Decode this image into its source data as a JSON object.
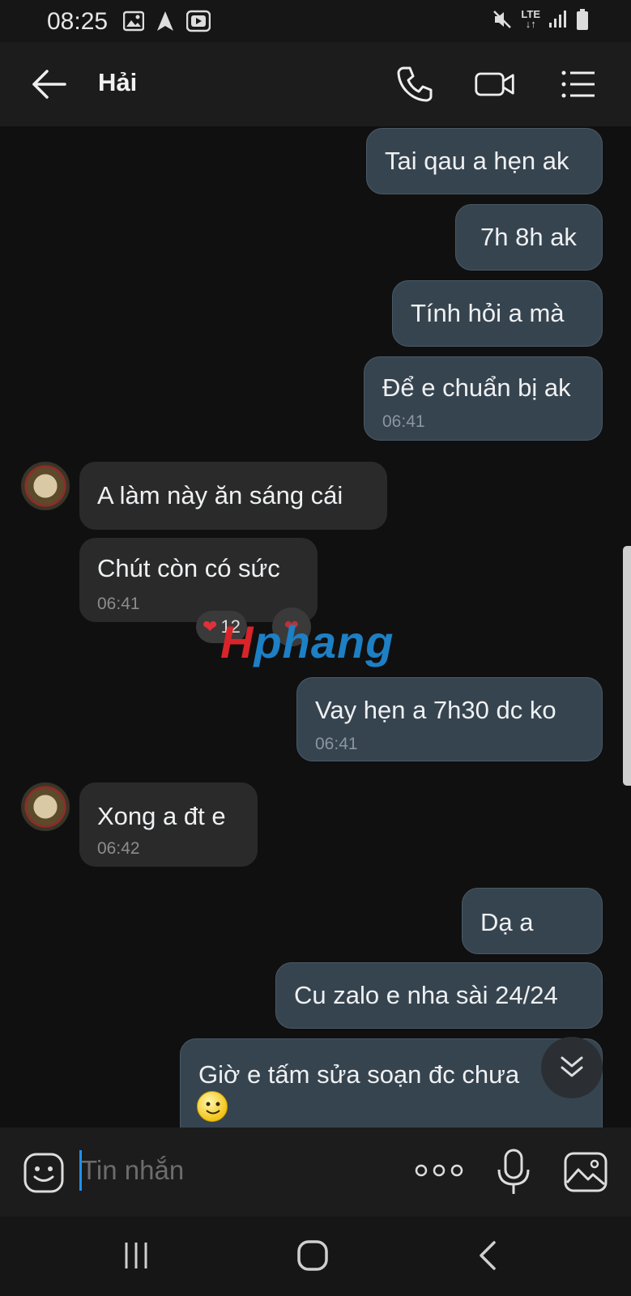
{
  "status_bar": {
    "time": "08:25",
    "network": "LTE"
  },
  "header": {
    "contact_name": "Hải"
  },
  "messages": [
    {
      "dir": "out",
      "text": "Tai qau a hẹn ak",
      "time": ""
    },
    {
      "dir": "out",
      "text": "7h 8h ak",
      "time": ""
    },
    {
      "dir": "out",
      "text": "Tính hỏi a mà",
      "time": ""
    },
    {
      "dir": "out",
      "text": "Để e chuẩn bị ak",
      "time": "06:41"
    },
    {
      "dir": "in",
      "text": "A làm này ăn sáng cái",
      "time": ""
    },
    {
      "dir": "in",
      "text": "Chút còn có sức",
      "time": "06:41"
    },
    {
      "dir": "out",
      "text": "Vay hẹn a 7h30 dc ko",
      "time": "06:41"
    },
    {
      "dir": "in",
      "text": "Xong a đt e",
      "time": "06:42"
    },
    {
      "dir": "out",
      "text": "Dạ a",
      "time": ""
    },
    {
      "dir": "out",
      "text": "Cu zalo e nha sài 24/24",
      "time": ""
    },
    {
      "dir": "out",
      "text": "Giờ e tấm sửa soạn đc chưa",
      "time": ""
    }
  ],
  "reaction": {
    "count": "12"
  },
  "watermark": {
    "part1": "H",
    "part2": "phang"
  },
  "input": {
    "placeholder": "Tin nhắn"
  },
  "colors": {
    "outgoing_bubble": "#36444f",
    "incoming_bubble": "#2a2a2a",
    "background": "#101010",
    "caret": "#1e90ff"
  },
  "icons": [
    "back-arrow-icon",
    "phone-icon",
    "video-call-icon",
    "menu-list-icon",
    "emoji-icon",
    "more-dots-icon",
    "microphone-icon",
    "image-icon",
    "scroll-down-chevron-icon",
    "nav-recents-icon",
    "nav-home-icon",
    "nav-back-icon"
  ]
}
